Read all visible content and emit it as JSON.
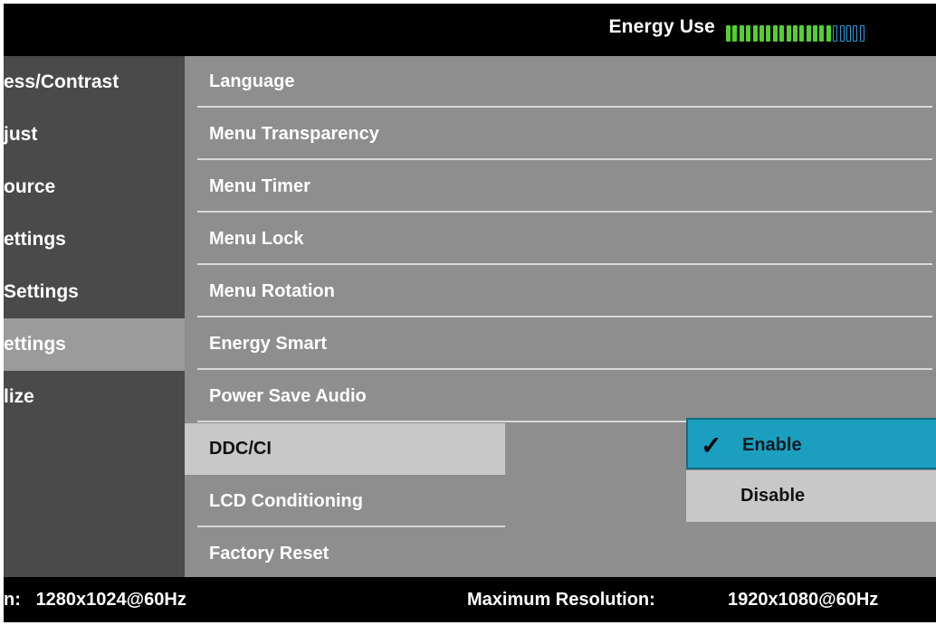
{
  "header": {
    "energy_label": "Energy Use",
    "energy_level": {
      "filled": 16,
      "total": 21
    },
    "colors": {
      "filled": "#52d12e",
      "empty": "#2f9ad9"
    }
  },
  "left_menu": {
    "items": [
      {
        "label": "ess/Contrast"
      },
      {
        "label": "just"
      },
      {
        "label": "ource"
      },
      {
        "label": "ettings"
      },
      {
        "label": " Settings"
      },
      {
        "label": "ettings",
        "selected": true
      },
      {
        "label": "lize"
      }
    ]
  },
  "main_menu": {
    "items": [
      {
        "label": "Language"
      },
      {
        "label": "Menu Transparency"
      },
      {
        "label": "Menu Timer"
      },
      {
        "label": "Menu Lock"
      },
      {
        "label": "Menu Rotation"
      },
      {
        "label": "Energy Smart"
      },
      {
        "label": "Power Save Audio"
      },
      {
        "label": "DDC/CI",
        "highlighted": true
      },
      {
        "label": "LCD Conditioning"
      },
      {
        "label": "Factory Reset"
      }
    ]
  },
  "submenu": {
    "enable": {
      "label": "Enable",
      "checked": true,
      "check_icon": "✓"
    },
    "disable": {
      "label": "Disable"
    }
  },
  "footer": {
    "current_label": "n:",
    "current_value": "1280x1024@60Hz",
    "max_label": "Maximum Resolution:",
    "max_value": "1920x1080@60Hz"
  },
  "colors": {
    "accent": "#1a9fbf",
    "selected_left": "#9b9b9b",
    "main_bg": "#8e8e8e",
    "highlight": "#c8c8c8"
  }
}
